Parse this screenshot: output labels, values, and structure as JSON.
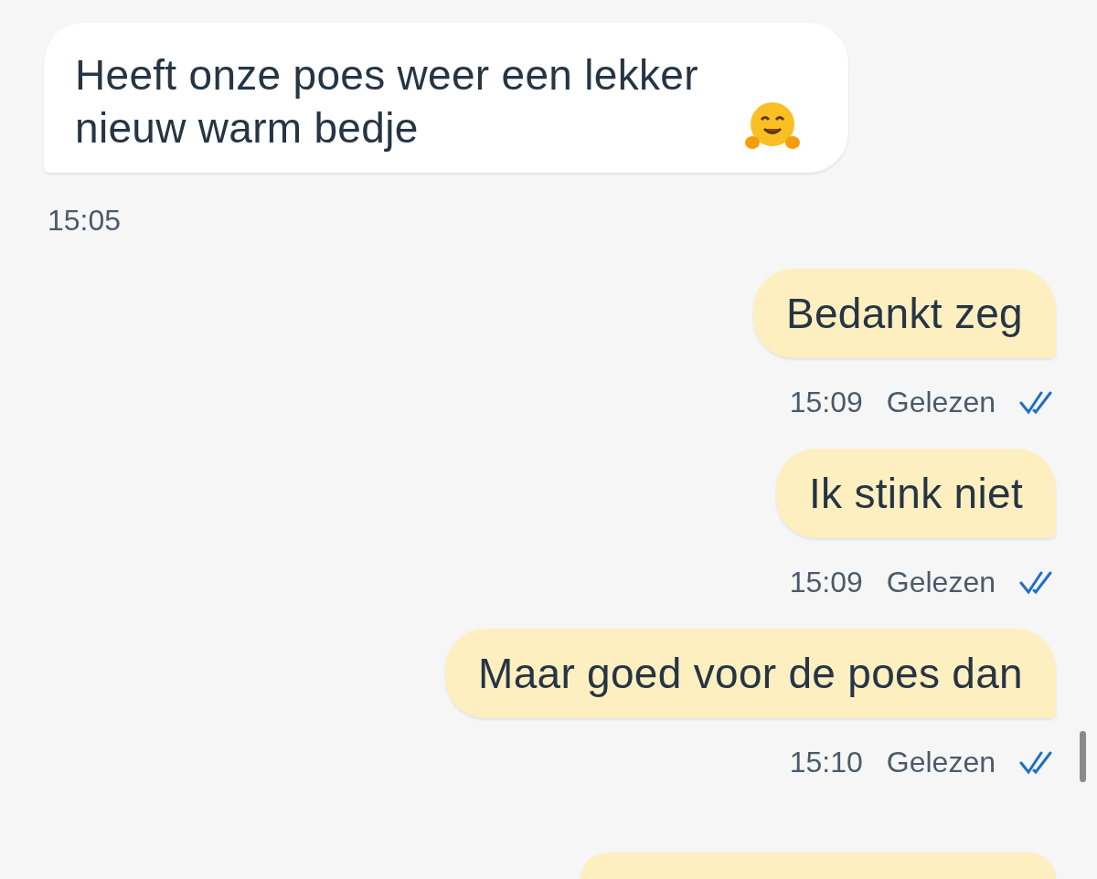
{
  "messages": [
    {
      "kind": "incoming",
      "text": "Heeft onze poes weer een lekker nieuw warm bedje",
      "emoji": true,
      "time": "15:05"
    },
    {
      "kind": "outgoing",
      "text": "Bedankt zeg",
      "time": "15:09",
      "status": "Gelezen",
      "read": true
    },
    {
      "kind": "outgoing",
      "text": "Ik stink niet",
      "time": "15:09",
      "status": "Gelezen",
      "read": true
    },
    {
      "kind": "outgoing",
      "text": "Maar goed voor de poes dan",
      "time": "15:10",
      "status": "Gelezen",
      "read": true
    },
    {
      "kind": "outgoing"
    }
  ]
}
